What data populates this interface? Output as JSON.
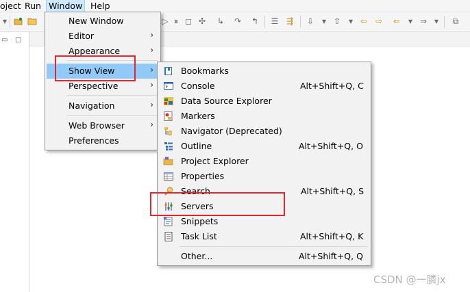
{
  "menubar": {
    "items": [
      {
        "label": "oject"
      },
      {
        "label": "Run"
      },
      {
        "label": "Window"
      },
      {
        "label": "Help"
      }
    ]
  },
  "window_menu": {
    "items": [
      {
        "label": "New Window",
        "submenu": false
      },
      {
        "label": "Editor",
        "submenu": true
      },
      {
        "label": "Appearance",
        "submenu": true
      },
      {
        "label": "Show View",
        "submenu": true,
        "highlighted": true
      },
      {
        "label": "Perspective",
        "submenu": true
      },
      {
        "label": "Navigation",
        "submenu": true
      },
      {
        "label": "Web Browser",
        "submenu": true
      },
      {
        "label": "Preferences",
        "submenu": false
      }
    ]
  },
  "show_view_menu": {
    "items": [
      {
        "label": "Bookmarks",
        "shortcut": "",
        "icon": "bookmarks-icon"
      },
      {
        "label": "Console",
        "shortcut": "Alt+Shift+Q, C",
        "icon": "console-icon"
      },
      {
        "label": "Data Source Explorer",
        "shortcut": "",
        "icon": "data-source-explorer-icon"
      },
      {
        "label": "Markers",
        "shortcut": "",
        "icon": "markers-icon"
      },
      {
        "label": "Navigator (Deprecated)",
        "shortcut": "",
        "icon": "navigator-icon"
      },
      {
        "label": "Outline",
        "shortcut": "Alt+Shift+Q, O",
        "icon": "outline-icon"
      },
      {
        "label": "Project Explorer",
        "shortcut": "",
        "icon": "project-explorer-icon"
      },
      {
        "label": "Properties",
        "shortcut": "",
        "icon": "properties-icon"
      },
      {
        "label": "Search",
        "shortcut": "Alt+Shift+Q, S",
        "icon": "search-icon"
      },
      {
        "label": "Servers",
        "shortcut": "",
        "icon": "servers-icon"
      },
      {
        "label": "Snippets",
        "shortcut": "",
        "icon": "snippets-icon"
      },
      {
        "label": "Task List",
        "shortcut": "Alt+Shift+Q, K",
        "icon": "task-list-icon"
      },
      {
        "label": "Other...",
        "shortcut": "Alt+Shift+Q, Q",
        "icon": ""
      }
    ]
  },
  "colors": {
    "highlight": "#91c9f7",
    "annotation": "#e8242c",
    "menu_bg": "#f2f2f2"
  },
  "watermark": "CSDN @一膦jx"
}
